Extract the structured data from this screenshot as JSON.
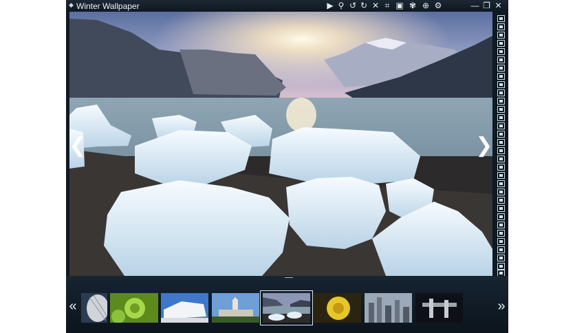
{
  "window": {
    "title": "Winter Wallpaper",
    "title_caret": "◆"
  },
  "toolbar": {
    "items": [
      {
        "name": "play-icon",
        "glyph": "▶"
      },
      {
        "name": "zoom-icon",
        "glyph": "⚲"
      },
      {
        "name": "rotate-left-icon",
        "glyph": "↺"
      },
      {
        "name": "rotate-right-icon",
        "glyph": "↻"
      },
      {
        "name": "close-image-icon",
        "glyph": "✕"
      },
      {
        "name": "crop-icon",
        "glyph": "⌗"
      },
      {
        "name": "fit-icon",
        "glyph": "▣"
      },
      {
        "name": "effects-icon",
        "glyph": "✾"
      },
      {
        "name": "pan-icon",
        "glyph": "⊕"
      },
      {
        "name": "settings-icon",
        "glyph": "⚙"
      }
    ]
  },
  "window_controls": {
    "minimize": "—",
    "restore": "❐",
    "close": "✕"
  },
  "navigation": {
    "prev": "❮",
    "next": "❯"
  },
  "filmstrip": {
    "prev": "«",
    "next": "»",
    "selected_index": 4
  },
  "colors": {
    "window_bg": "#0e1a24",
    "accent": "#dfe7ec"
  }
}
